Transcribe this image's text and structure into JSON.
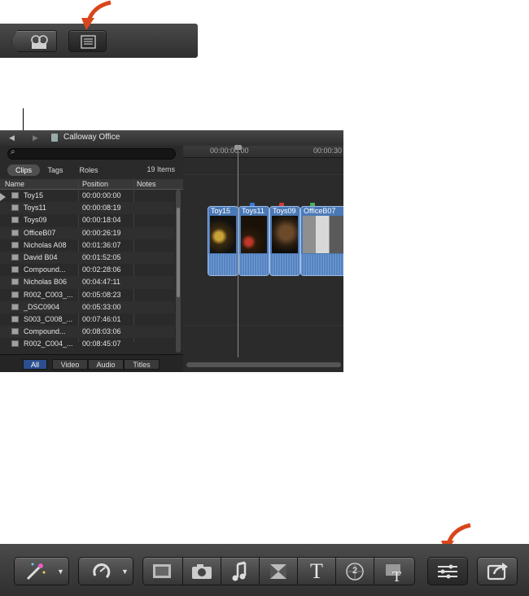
{
  "event_browser": {
    "title": "Calloway Office",
    "filters": {
      "clips": "Clips",
      "tags": "Tags",
      "roles": "Roles"
    },
    "item_count": "19 Items",
    "columns": {
      "name": "Name",
      "position": "Position",
      "notes": "Notes"
    },
    "rows": [
      {
        "name": "Toy15",
        "position": "00:00:00:00"
      },
      {
        "name": "Toys11",
        "position": "00:00:08:19"
      },
      {
        "name": "Toys09",
        "position": "00:00:18:04"
      },
      {
        "name": "OfficeB07",
        "position": "00:00:26:19"
      },
      {
        "name": "Nicholas A08",
        "position": "00:01:36:07"
      },
      {
        "name": "David B04",
        "position": "00:01:52:05"
      },
      {
        "name": "Compound...",
        "position": "00:02:28:06"
      },
      {
        "name": "Nicholas B06",
        "position": "00:04:47:11"
      },
      {
        "name": "R002_C003_...",
        "position": "00:05:08:23"
      },
      {
        "name": "_DSC0904",
        "position": "00:05:33:00"
      },
      {
        "name": "S003_C008_...",
        "position": "00:07:46:01"
      },
      {
        "name": "Compound...",
        "position": "00:08:03:06"
      },
      {
        "name": "R002_C004_...",
        "position": "00:08:45:07"
      }
    ],
    "bottom_filters": {
      "all": "All",
      "video": "Video",
      "audio": "Audio",
      "titles": "Titles"
    }
  },
  "timeline": {
    "timecode_start": "00:00:00:00",
    "timecode_next": "00:00:30",
    "clips": [
      "Toy15",
      "Toys11",
      "Toys09",
      "OfficeB07"
    ]
  },
  "colors": {
    "accent_arrow": "#d9461c",
    "clip_blue": "#4a79b7",
    "marker_blue": "#3a7bd5",
    "marker_red": "#d23a3a",
    "marker_green": "#4caf50"
  },
  "icons": {
    "top_toolbar": [
      "film-reel-icon",
      "list-view-icon"
    ],
    "bottom_toolbar": [
      "magic-wand-icon",
      "retime-icon",
      "media-browser-icon",
      "photo-icon",
      "music-icon",
      "transitions-icon",
      "titles-icon",
      "generators-icon",
      "themes-icon",
      "inspector-icon",
      "share-icon"
    ]
  },
  "bottom_toolbar": {
    "titles_glyph": "T",
    "generator_glyph": "2"
  }
}
